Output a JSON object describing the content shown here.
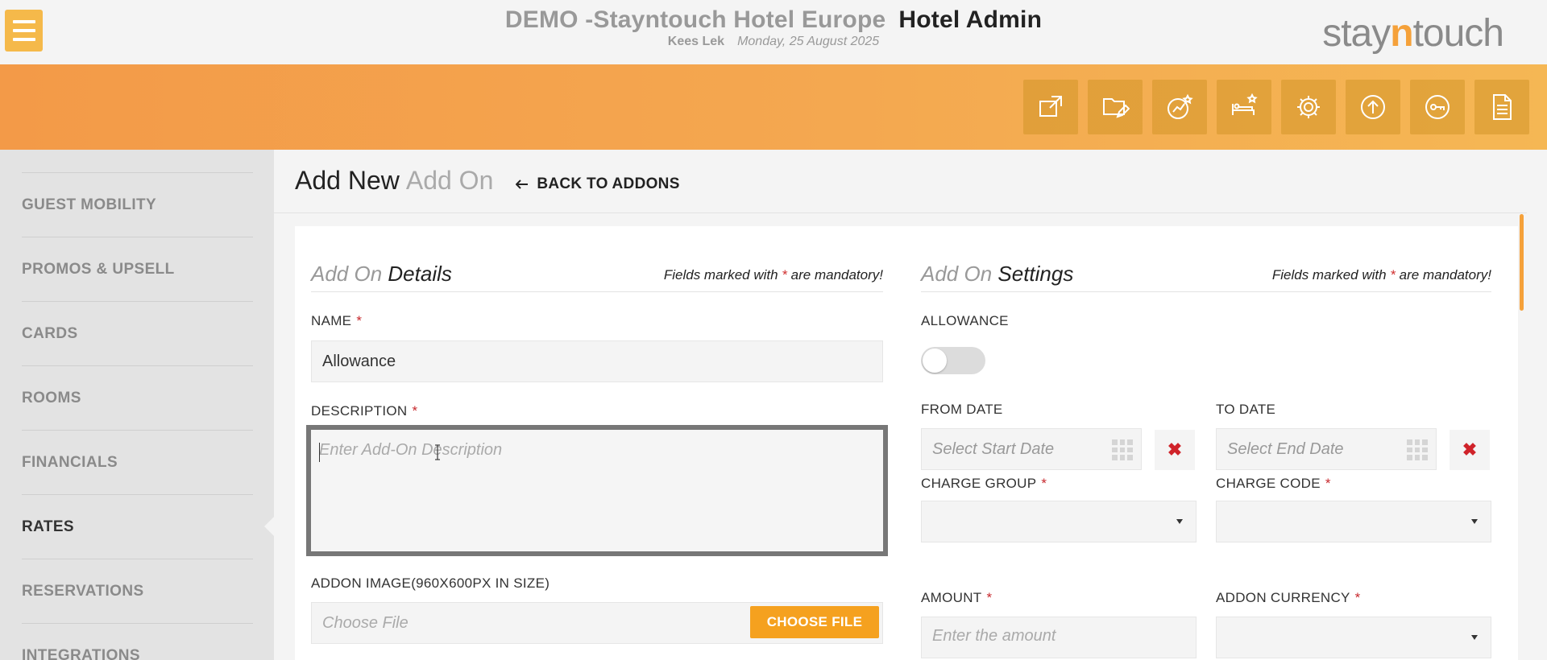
{
  "topbar": {
    "hotel_name": "DEMO -Stayntouch Hotel Europe",
    "app_name": "Hotel Admin",
    "user_name": "Kees Lek",
    "date": "Monday, 25 August 2025",
    "logo_left": "stay",
    "logo_mid": "n",
    "logo_right": "touch"
  },
  "toolbar_icons": [
    "external-link-icon",
    "folder-edit-icon",
    "chart-star-icon",
    "bed-star-icon",
    "gear-icon",
    "upload-icon",
    "key-icon",
    "document-icon"
  ],
  "sidebar": {
    "items": [
      {
        "label": "GUEST MOBILITY"
      },
      {
        "label": "PROMOS & UPSELL"
      },
      {
        "label": "CARDS"
      },
      {
        "label": "ROOMS"
      },
      {
        "label": "FINANCIALS"
      },
      {
        "label": "RATES",
        "active": true
      },
      {
        "label": "RESERVATIONS"
      },
      {
        "label": "INTEGRATIONS"
      }
    ]
  },
  "page": {
    "title": "Add New",
    "title_sub": "Add On",
    "back_label": "BACK TO ADDONS"
  },
  "details": {
    "title_light": "Add On",
    "title_bold": "Details",
    "note_pre": "Fields marked with",
    "note_star": "*",
    "note_post": "are mandatory!",
    "name_label": "NAME",
    "name_value": "Allowance",
    "description_label": "DESCRIPTION",
    "description_placeholder": "Enter Add-On Description",
    "image_label": "ADDON IMAGE(960X600PX IN SIZE)",
    "file_placeholder": "Choose File",
    "choose_file_label": "CHOOSE FILE",
    "required_mark": "*"
  },
  "settings": {
    "title_light": "Add On",
    "title_bold": "Settings",
    "note_pre": "Fields marked with",
    "note_star": "*",
    "note_post": "are mandatory!",
    "allowance_label": "ALLOWANCE",
    "allowance_on": false,
    "from_date_label": "FROM DATE",
    "from_date_placeholder": "Select Start Date",
    "to_date_label": "TO DATE",
    "to_date_placeholder": "Select End Date",
    "clear_symbol": "✖",
    "charge_group_label": "CHARGE GROUP",
    "charge_code_label": "CHARGE CODE",
    "amount_label": "AMOUNT",
    "amount_placeholder": "Enter the amount",
    "currency_label": "ADDON CURRENCY",
    "required_mark": "*"
  },
  "colors": {
    "accent_orange": "#f5a11f",
    "required_red": "#c7282d"
  }
}
